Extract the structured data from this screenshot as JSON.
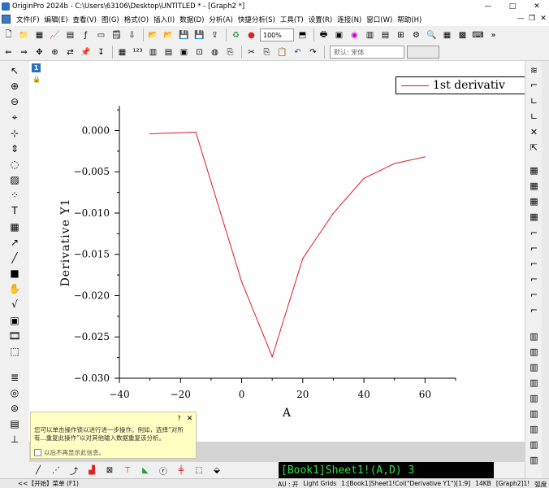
{
  "window": {
    "title": "OriginPro 2024b - C:\\Users\\63106\\Desktop\\UNTITLED * - [Graph2 *]",
    "minimize": "—",
    "maximize": "□",
    "close": "✕"
  },
  "menu": {
    "items": [
      "文件(F)",
      "编辑(E)",
      "查看(V)",
      "图(G)",
      "格式(O)",
      "插入(I)",
      "数据(D)",
      "分析(A)",
      "快捷分析(S)",
      "工具(T)",
      "设置(R)",
      "连接(N)",
      "窗口(W)",
      "帮助(H)"
    ],
    "mdi_minimize": "—",
    "mdi_restore": "❐",
    "mdi_close": "✕"
  },
  "toolbar": {
    "zoom": "100%",
    "font": "默认: 宋体"
  },
  "graph": {
    "layer_number": "1",
    "legend_label": "1st derivativ",
    "line_color": "#e01b1b"
  },
  "chart_data": {
    "type": "line",
    "xlabel": "A",
    "ylabel": "Derivative Y1",
    "xlim": [
      -40,
      70
    ],
    "ylim": [
      -0.03,
      0.003
    ],
    "x_ticks": [
      -40,
      -20,
      0,
      20,
      40,
      60
    ],
    "x_tick_labels": [
      "−40",
      "−20",
      "0",
      "20",
      "40",
      "60"
    ],
    "y_ticks": [
      0.0,
      -0.005,
      -0.01,
      -0.015,
      -0.02,
      -0.025,
      -0.03
    ],
    "y_tick_labels": [
      "0.000",
      "−0.005",
      "−0.010",
      "−0.015",
      "−0.020",
      "−0.025",
      "−0.030"
    ],
    "series": [
      {
        "name": "1st derivativ",
        "x": [
          -30,
          -15,
          0,
          10,
          20,
          30,
          40,
          50,
          60
        ],
        "y": [
          -0.0004,
          -0.0002,
          -0.0183,
          -0.0274,
          -0.0155,
          -0.01,
          -0.0058,
          -0.004,
          -0.0032
        ]
      }
    ]
  },
  "tooltip": {
    "help": "?",
    "close": "✕",
    "text": "您可以单击操作锁以进行进一步操作。例如，选择“对所有...重复此操作”以对其他输入数据重复该分析。",
    "checkbox_label": "以后不再显示此信息。"
  },
  "dataset": {
    "text": "[Book1]Sheet1!(A,D) 3"
  },
  "status": {
    "start": "<<【开始】菜单 (F1)",
    "au": "AU : 开",
    "grid": "Light Grids",
    "sheet": "1:[Book1]Sheet1!Col(\"Derivative Y1\")[1:9]",
    "size": "14KB",
    "graph": "[Graph2]1!",
    "unit": "弧度"
  }
}
